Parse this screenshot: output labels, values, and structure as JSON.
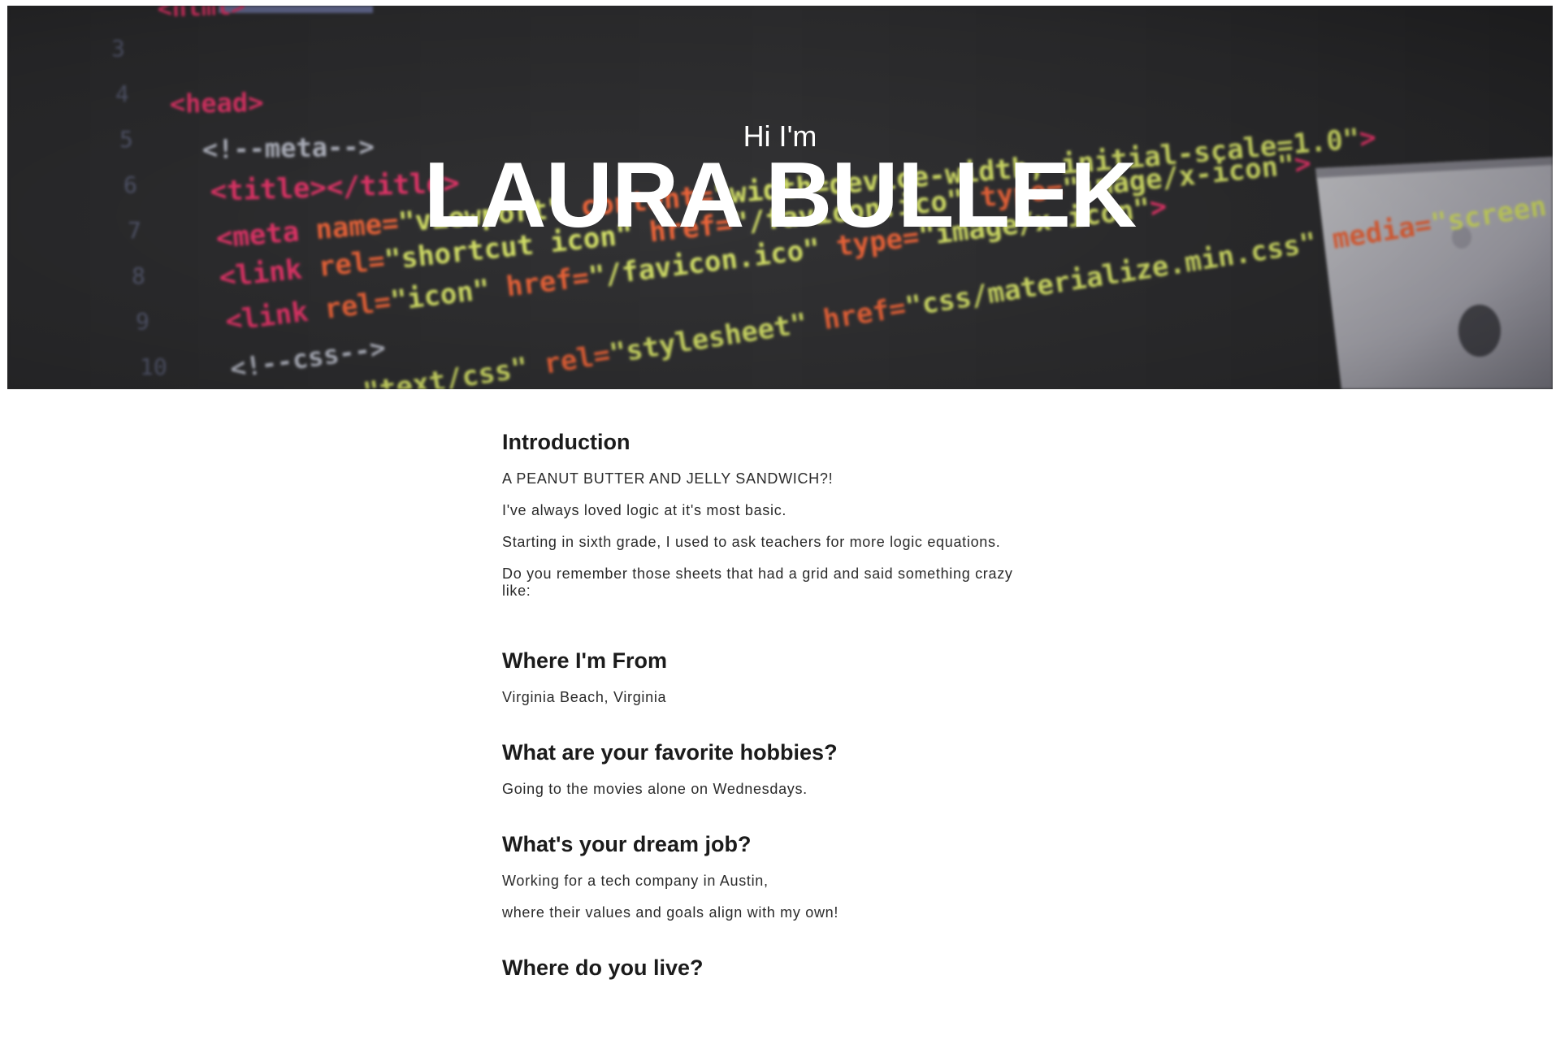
{
  "hero": {
    "greeting": "Hi I'm",
    "name": "LAURA BULLEK",
    "code_lines": [
      "<html>",
      "<head>",
      "<!--meta-->",
      "<title></title>",
      "<meta name=\"viewport\" content=\"width=device-width, initial-scale=1.0\">",
      "<link rel=\"shortcut icon\" href=\"/favicon.ico\" type=\"image/x-icon\">",
      "<link rel=\"icon\" href=\"/favicon.ico\" type=\"image/x-icon\">",
      "<!--css-->",
      "\"text/css\" rel=\"stylesheet\" href=\"css/materialize.min.css\" media=\"screen,projection\">"
    ],
    "line_numbers": [
      "3",
      "4",
      "5",
      "6",
      "7",
      "8",
      "9",
      "10"
    ]
  },
  "sections": [
    {
      "heading": "Introduction",
      "paragraphs": [
        "A PEANUT BUTTER AND JELLY SANDWICH?!",
        "I've always loved logic at it's most basic.",
        "Starting in sixth grade, I used to ask teachers for more logic equations.",
        "Do you remember those sheets that had a grid and said something crazy like:"
      ]
    },
    {
      "heading": "Where I'm From",
      "paragraphs": [
        "Virginia Beach, Virginia"
      ]
    },
    {
      "heading": "What are your favorite hobbies?",
      "paragraphs": [
        "Going to the movies alone on Wednesdays."
      ]
    },
    {
      "heading": "What's your dream job?",
      "paragraphs": [
        "Working for a tech company in Austin,",
        "where their values and goals align with my own!"
      ]
    },
    {
      "heading": "Where do you live?",
      "paragraphs": []
    }
  ],
  "colors": {
    "hero_bg": "#2f2f30",
    "code_tag": "#e8366b",
    "code_attr": "#f0663a",
    "code_string": "#d9e66a",
    "code_comment": "#b9bcc8",
    "text": "#1f1f1f"
  }
}
